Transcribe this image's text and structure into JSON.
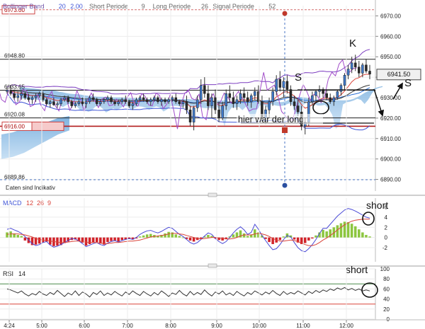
{
  "chart_data": {
    "type": "candlestick",
    "x_ticks": [
      "4:24",
      "5:00",
      "6:00",
      "7:00",
      "8:00",
      "9:00",
      "10:00",
      "11:00",
      "12:00"
    ],
    "price": {
      "header": [
        {
          "text": "Bollinger Band",
          "color": "#6b4fa8"
        },
        {
          "text": "20",
          "color": "#3f54d6"
        },
        {
          "text": "2.00",
          "color": "#3f54d6"
        },
        {
          "text": "Short Periode",
          "color": "#666666"
        },
        {
          "text": "9",
          "color": "#666666"
        },
        {
          "text": "Long Periode",
          "color": "#666666"
        },
        {
          "text": "26",
          "color": "#666666"
        },
        {
          "text": "Signal Periode",
          "color": "#666666"
        },
        {
          "text": "52",
          "color": "#666666"
        }
      ],
      "ylim": [
        6885,
        6975
      ],
      "y_ticks": [
        6890,
        6900,
        6910,
        6920,
        6930,
        6940,
        6950,
        6960,
        6970
      ],
      "y_tick_labels": [
        "6890.00",
        "6900.00",
        "6910.00",
        "6920.00",
        "6930.00",
        "6940.00",
        "6950.00",
        "6960.00",
        "6970.00"
      ],
      "last_price": 6941.5,
      "last_price_label": "6941.50",
      "left_tags": [
        {
          "value": 6973.0,
          "label": "6973.00",
          "style": "boxed"
        },
        {
          "value": 6948.8,
          "label": "6948.80",
          "style": "line"
        },
        {
          "value": 6933.65,
          "label": "6933.65",
          "style": "line"
        },
        {
          "value": 6920.08,
          "label": "6920.08",
          "style": "line"
        },
        {
          "value": 6916.0,
          "label": "6916.00",
          "style": "red"
        },
        {
          "value": 6889.86,
          "label": "6889.86",
          "style": "dashed"
        }
      ],
      "footer_note": "Daten sind Indikativ",
      "candles": [
        [
          6933,
          6935,
          6932,
          6933.65
        ],
        [
          6933.65,
          6936,
          6931,
          6932
        ],
        [
          6932,
          6934,
          6929,
          6930
        ],
        [
          6930,
          6933,
          6928,
          6931
        ],
        [
          6931,
          6933,
          6929,
          6932
        ],
        [
          6932,
          6933,
          6929,
          6930
        ],
        [
          6930,
          6932,
          6928,
          6929
        ],
        [
          6929,
          6931,
          6927,
          6930
        ],
        [
          6930,
          6932,
          6928,
          6931
        ],
        [
          6931,
          6933,
          6930,
          6932
        ],
        [
          6932,
          6933,
          6928,
          6929
        ],
        [
          6929,
          6930,
          6926,
          6927
        ],
        [
          6927,
          6929,
          6925,
          6928
        ],
        [
          6928,
          6930,
          6926,
          6926.5
        ],
        [
          6926.5,
          6928,
          6925,
          6927
        ],
        [
          6927,
          6930,
          6926,
          6929
        ],
        [
          6929,
          6931,
          6928,
          6930
        ],
        [
          6930,
          6931,
          6927,
          6928
        ],
        [
          6928,
          6929,
          6925,
          6926
        ],
        [
          6926,
          6928,
          6925,
          6927
        ],
        [
          6927,
          6929,
          6926,
          6928
        ],
        [
          6928,
          6930,
          6926,
          6927
        ],
        [
          6927,
          6929,
          6925,
          6928
        ],
        [
          6928,
          6931,
          6927,
          6930
        ],
        [
          6930,
          6932,
          6928,
          6929
        ],
        [
          6929,
          6930,
          6926,
          6927
        ],
        [
          6927,
          6929,
          6926,
          6928
        ],
        [
          6928,
          6930,
          6927,
          6929
        ],
        [
          6929,
          6931,
          6928,
          6930
        ],
        [
          6930,
          6931,
          6927,
          6928
        ],
        [
          6928,
          6929,
          6926,
          6927
        ],
        [
          6927,
          6929,
          6926,
          6928
        ],
        [
          6928,
          6930,
          6927,
          6929
        ],
        [
          6929,
          6931,
          6927,
          6928
        ],
        [
          6928,
          6929,
          6925,
          6926
        ],
        [
          6926,
          6928,
          6924,
          6927
        ],
        [
          6927,
          6930,
          6926,
          6929
        ],
        [
          6929,
          6931,
          6928,
          6930
        ],
        [
          6930,
          6932,
          6928,
          6929
        ],
        [
          6929,
          6930,
          6927,
          6928
        ],
        [
          6928,
          6930,
          6926,
          6929
        ],
        [
          6929,
          6931,
          6928,
          6930
        ],
        [
          6930,
          6931,
          6927,
          6928
        ],
        [
          6928,
          6930,
          6926,
          6929
        ],
        [
          6929,
          6930,
          6927,
          6928
        ],
        [
          6928,
          6930,
          6927,
          6929
        ],
        [
          6929,
          6931,
          6928,
          6930
        ],
        [
          6930,
          6932,
          6927,
          6928
        ],
        [
          6928,
          6929,
          6926,
          6927
        ],
        [
          6927,
          6929,
          6925,
          6928
        ],
        [
          6928,
          6931,
          6922,
          6924
        ],
        [
          6924,
          6926,
          6916,
          6918
        ],
        [
          6918,
          6926,
          6914,
          6925
        ],
        [
          6925,
          6931,
          6923,
          6929
        ],
        [
          6929,
          6939,
          6927,
          6936
        ],
        [
          6936,
          6940,
          6930,
          6932
        ],
        [
          6932,
          6936,
          6924,
          6926
        ],
        [
          6926,
          6932,
          6920,
          6930
        ],
        [
          6930,
          6934,
          6922,
          6924
        ],
        [
          6924,
          6928,
          6918,
          6920
        ],
        [
          6920,
          6928,
          6919,
          6926
        ],
        [
          6926,
          6934,
          6924,
          6932
        ],
        [
          6932,
          6936,
          6928,
          6930
        ],
        [
          6930,
          6933,
          6925,
          6927
        ],
        [
          6927,
          6931,
          6924,
          6929
        ],
        [
          6929,
          6934,
          6927,
          6932
        ],
        [
          6932,
          6935,
          6928,
          6930
        ],
        [
          6930,
          6933,
          6926,
          6928
        ],
        [
          6928,
          6932,
          6925,
          6931
        ],
        [
          6931,
          6935,
          6929,
          6933
        ],
        [
          6933,
          6936,
          6927,
          6928
        ],
        [
          6928,
          6931,
          6918,
          6920
        ],
        [
          6920,
          6926,
          6917,
          6924
        ],
        [
          6924,
          6930,
          6920,
          6928
        ],
        [
          6928,
          6935,
          6926,
          6933
        ],
        [
          6933,
          6941,
          6931,
          6939
        ],
        [
          6939,
          6943,
          6933,
          6935
        ],
        [
          6935,
          6940,
          6930,
          6938
        ],
        [
          6938,
          6941,
          6932,
          6934
        ],
        [
          6934,
          6936,
          6926,
          6928
        ],
        [
          6928,
          6931,
          6924,
          6926
        ],
        [
          6926,
          6929,
          6921,
          6923
        ],
        [
          6923,
          6926,
          6914,
          6916
        ],
        [
          6916,
          6920,
          6912,
          6918
        ],
        [
          6918,
          6930,
          6916,
          6928
        ],
        [
          6928,
          6933,
          6926,
          6931
        ],
        [
          6931,
          6934,
          6928,
          6933
        ],
        [
          6933,
          6936,
          6930,
          6934
        ],
        [
          6934,
          6935,
          6930,
          6932
        ],
        [
          6932,
          6934,
          6929,
          6930
        ],
        [
          6930,
          6932,
          6927,
          6928
        ],
        [
          6928,
          6931,
          6926,
          6930
        ],
        [
          6930,
          6934,
          6929,
          6933
        ],
        [
          6933,
          6937,
          6931,
          6936
        ],
        [
          6936,
          6942,
          6934,
          6941
        ],
        [
          6941,
          6946,
          6939,
          6944
        ],
        [
          6944,
          6950,
          6942,
          6947
        ],
        [
          6947,
          6951,
          6943,
          6945
        ],
        [
          6945,
          6948,
          6940,
          6942
        ],
        [
          6942,
          6947,
          6940,
          6946
        ],
        [
          6946,
          6949,
          6942,
          6943
        ],
        [
          6943,
          6946,
          6939,
          6941.5
        ]
      ]
    },
    "macd": {
      "title": "MACD",
      "params": [
        "12",
        "26",
        "9"
      ],
      "ylim": [
        -4.5,
        7.6
      ],
      "y_ticks": [
        -2,
        0,
        2,
        4,
        6
      ],
      "y_tick_labels": [
        "-2",
        "0",
        "2",
        "4",
        "6"
      ],
      "histogram": [
        1.0,
        1.2,
        0.8,
        0.5,
        0.3,
        -0.6,
        -1.1,
        -1.5,
        -1.4,
        -1.2,
        -1.0,
        -0.8,
        -1.4,
        -1.7,
        -1.6,
        -1.5,
        -1.1,
        -0.8,
        -0.5,
        -0.4,
        -0.7,
        -1.0,
        -1.6,
        -1.3,
        -1.0,
        -0.9,
        -1.2,
        -1.4,
        -0.9,
        -0.7,
        -0.6,
        -0.8,
        -0.5,
        -0.4,
        -0.3,
        -0.4,
        -0.2,
        0.2,
        0.4,
        0.6,
        0.7,
        0.5,
        0.3,
        0.5,
        0.8,
        1.1,
        1.0,
        0.6,
        0.3,
        0.0,
        -0.3,
        -0.6,
        -0.8,
        -0.5,
        -0.2,
        0.2,
        0.5,
        0.3,
        -0.2,
        -0.5,
        -0.6,
        -0.3,
        0.2,
        0.6,
        1.0,
        1.4,
        0.8,
        0.3,
        0.6,
        1.6,
        1.0,
        0.4,
        -0.3,
        -0.9,
        -1.3,
        -1.0,
        -0.5,
        0.2,
        0.8,
        0.4,
        -0.4,
        -1.0,
        -1.3,
        -1.1,
        -0.6,
        -0.2,
        0.4,
        1.0,
        1.5,
        1.2,
        1.6,
        2.0,
        2.4,
        2.8,
        3.1,
        3.0,
        2.7,
        2.2,
        1.6,
        1.0,
        0.5,
        0.2
      ],
      "macd": [
        1.6,
        1.8,
        1.5,
        1.2,
        0.8,
        0.2,
        -0.5,
        -1.2,
        -1.6,
        -1.4,
        -1.0,
        -0.8,
        -1.5,
        -1.9,
        -1.7,
        -1.4,
        -1.0,
        -0.6,
        -0.2,
        -0.3,
        -0.7,
        -1.2,
        -1.8,
        -1.5,
        -1.2,
        -1.0,
        -1.4,
        -1.6,
        -1.1,
        -0.8,
        -0.6,
        -0.9,
        -0.6,
        -0.4,
        -0.2,
        -0.4,
        0.0,
        0.6,
        1.0,
        1.3,
        1.4,
        1.1,
        0.9,
        1.2,
        1.6,
        2.0,
        1.8,
        1.2,
        0.6,
        0.2,
        -0.4,
        -1.0,
        -1.3,
        -1.0,
        -0.4,
        0.3,
        0.9,
        0.6,
        -0.2,
        -0.8,
        -1.2,
        -0.8,
        0.0,
        0.9,
        1.6,
        2.1,
        1.5,
        0.6,
        1.0,
        2.6,
        1.6,
        0.4,
        -0.6,
        -1.6,
        -2.4,
        -2.2,
        -1.4,
        -0.4,
        0.4,
        0.1,
        -1.0,
        -2.0,
        -2.6,
        -2.8,
        -2.2,
        -1.4,
        -0.4,
        0.8,
        1.8,
        1.8,
        2.6,
        3.4,
        4.2,
        4.8,
        5.4,
        5.7,
        5.5,
        5.2,
        4.8,
        4.4,
        4.0,
        3.8
      ],
      "signal": [
        0.6,
        0.7,
        0.7,
        0.7,
        0.6,
        0.5,
        0.3,
        0.1,
        -0.2,
        -0.4,
        -0.5,
        -0.6,
        -0.7,
        -0.8,
        -0.9,
        -1.0,
        -1.0,
        -0.9,
        -0.8,
        -0.7,
        -0.7,
        -0.8,
        -0.9,
        -1.0,
        -1.0,
        -1.0,
        -1.1,
        -1.2,
        -1.2,
        -1.1,
        -1.0,
        -1.0,
        -0.9,
        -0.8,
        -0.7,
        -0.7,
        -0.6,
        -0.5,
        -0.3,
        -0.1,
        0.1,
        0.2,
        0.3,
        0.4,
        0.5,
        0.7,
        0.8,
        0.8,
        0.7,
        0.6,
        0.4,
        0.2,
        0.0,
        -0.2,
        -0.3,
        -0.2,
        -0.1,
        0.0,
        0.0,
        -0.1,
        -0.2,
        -0.3,
        -0.3,
        -0.2,
        0.0,
        0.3,
        0.5,
        0.5,
        0.5,
        0.7,
        0.8,
        0.7,
        0.5,
        0.2,
        -0.2,
        -0.5,
        -0.7,
        -0.7,
        -0.6,
        -0.5,
        -0.6,
        -0.8,
        -1.1,
        -1.4,
        -1.6,
        -1.6,
        -1.4,
        -1.0,
        -0.5,
        -0.1,
        0.4,
        0.9,
        1.5,
        2.0,
        2.5,
        2.9,
        3.2,
        3.4,
        3.5,
        3.6,
        3.6,
        3.6
      ]
    },
    "rsi": {
      "title": "RSI",
      "period": "14",
      "ylim": [
        0,
        100
      ],
      "y_ticks": [
        0,
        20,
        40,
        60,
        80,
        100
      ],
      "y_tick_labels": [
        "0",
        "20",
        "40",
        "60",
        "80",
        "100"
      ],
      "bands": [
        30,
        70
      ],
      "values": [
        60,
        58,
        55,
        52,
        56,
        50,
        46,
        51,
        48,
        55,
        50,
        47,
        53,
        49,
        57,
        51,
        45,
        52,
        48,
        56,
        47,
        54,
        50,
        44,
        53,
        49,
        56,
        47,
        52,
        48,
        55,
        50,
        46,
        54,
        49,
        56,
        51,
        47,
        55,
        50,
        46,
        53,
        48,
        56,
        51,
        45,
        52,
        49,
        57,
        50,
        46,
        55,
        48,
        53,
        49,
        58,
        51,
        46,
        54,
        50,
        56,
        48,
        52,
        47,
        55,
        50,
        46,
        53,
        49,
        56,
        52,
        48,
        54,
        50,
        57,
        51,
        47,
        55,
        49,
        53,
        50,
        56,
        52,
        48,
        55,
        51,
        57,
        53,
        58,
        55,
        60,
        57,
        62,
        59,
        63,
        58,
        61,
        57,
        60,
        56,
        58,
        56
      ]
    },
    "annotations": {
      "k": "K",
      "s1": "S",
      "s2": "S",
      "long": "hier war der long",
      "short_macd": "short",
      "short_rsi": "short"
    }
  }
}
